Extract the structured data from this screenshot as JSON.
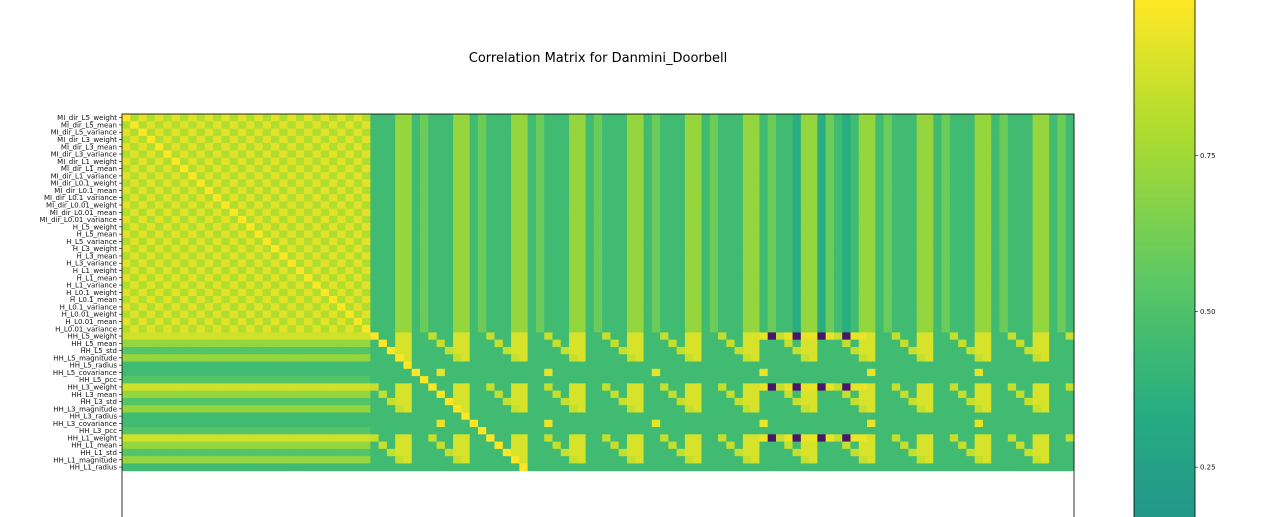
{
  "chart_data": {
    "type": "heatmap",
    "title": "Correlation Matrix for Danmini_Doorbell",
    "row_labels": [
      "MI_dir_L5_weight",
      "MI_dir_L5_mean",
      "MI_dir_L5_variance",
      "MI_dir_L3_weight",
      "MI_dir_L3_mean",
      "MI_dir_L3_variance",
      "MI_dir_L1_weight",
      "MI_dir_L1_mean",
      "MI_dir_L1_variance",
      "MI_dir_L0.1_weight",
      "MI_dir_L0.1_mean",
      "MI_dir_L0.1_variance",
      "MI_dir_L0.01_weight",
      "MI_dir_L0.01_mean",
      "MI_dir_L0.01_variance",
      "H_L5_weight",
      "H_L5_mean",
      "H_L5_variance",
      "H_L3_weight",
      "H_L3_mean",
      "H_L3_variance",
      "H_L1_weight",
      "H_L1_mean",
      "H_L1_variance",
      "H_L0.1_weight",
      "H_L0.1_mean",
      "H_L0.1_variance",
      "H_L0.01_weight",
      "H_L0.01_mean",
      "H_L0.01_variance",
      "HH_L5_weight",
      "HH_L5_mean",
      "HH_L5_std",
      "HH_L5_magnitude",
      "HH_L5_radius",
      "HH_L5_covariance",
      "HH_L5_pcc",
      "HH_L3_weight",
      "HH_L3_mean",
      "HH_L3_std",
      "HH_L3_magnitude",
      "HH_L3_radius",
      "HH_L3_covariance",
      "HH_L3_pcc",
      "HH_L1_weight",
      "HH_L1_mean",
      "HH_L1_std",
      "HH_L1_magnitude",
      "HH_L1_radius"
    ],
    "colorbar_ticks": [
      {
        "value": 0.75,
        "label": "0.75"
      },
      {
        "value": 0.5,
        "label": "0.50"
      },
      {
        "value": 0.25,
        "label": "0.25"
      }
    ],
    "visible_value_range": [
      0.17,
      1.0
    ],
    "color_range": [
      -0.75,
      1.0
    ],
    "num_columns": 115,
    "colormap": "viridis",
    "grid": false
  }
}
